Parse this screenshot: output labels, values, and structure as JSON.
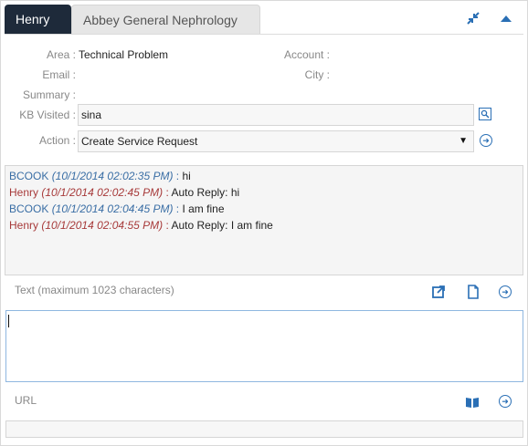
{
  "tabs": [
    {
      "label": "Henry",
      "active": true
    },
    {
      "label": "Abbey General Nephrology",
      "active": false
    }
  ],
  "header_icons": [
    "collapse-arrows-icon",
    "caret-up-icon"
  ],
  "form": {
    "area_label": "Area :",
    "area_value": "Technical Problem",
    "account_label": "Account :",
    "account_value": "",
    "email_label": "Email :",
    "email_value": "",
    "city_label": "City :",
    "city_value": "",
    "summary_label": "Summary :",
    "summary_value": "",
    "kb_label": "KB Visited :",
    "kb_value": "sina",
    "action_label": "Action :",
    "action_value": "Create Service Request",
    "action_arrow": "▼"
  },
  "chat": [
    {
      "who": "BCOOK",
      "time": "(10/1/2014 02:02:35 PM)",
      "sep": " : ",
      "text": "hi",
      "role": "agent"
    },
    {
      "who": "Henry",
      "time": "(10/1/2014 02:02:45 PM)",
      "sep": " : ",
      "text": "Auto Reply: hi",
      "role": "customer"
    },
    {
      "who": "BCOOK",
      "time": "(10/1/2014 02:04:45 PM)",
      "sep": " : ",
      "text": "I am fine",
      "role": "agent"
    },
    {
      "who": "Henry",
      "time": "(10/1/2014 02:04:55 PM)",
      "sep": " : ",
      "text": "Auto Reply: I am fine",
      "role": "customer"
    }
  ],
  "composer": {
    "text_label": "Text (maximum 1023 characters)",
    "text_value": "",
    "url_label": "URL",
    "url_value": ""
  },
  "colors": {
    "tab_active_bg": "#1e2a3a",
    "accent": "#2a6fb5",
    "agent": "#3a6ea5",
    "customer": "#a73a3a"
  }
}
